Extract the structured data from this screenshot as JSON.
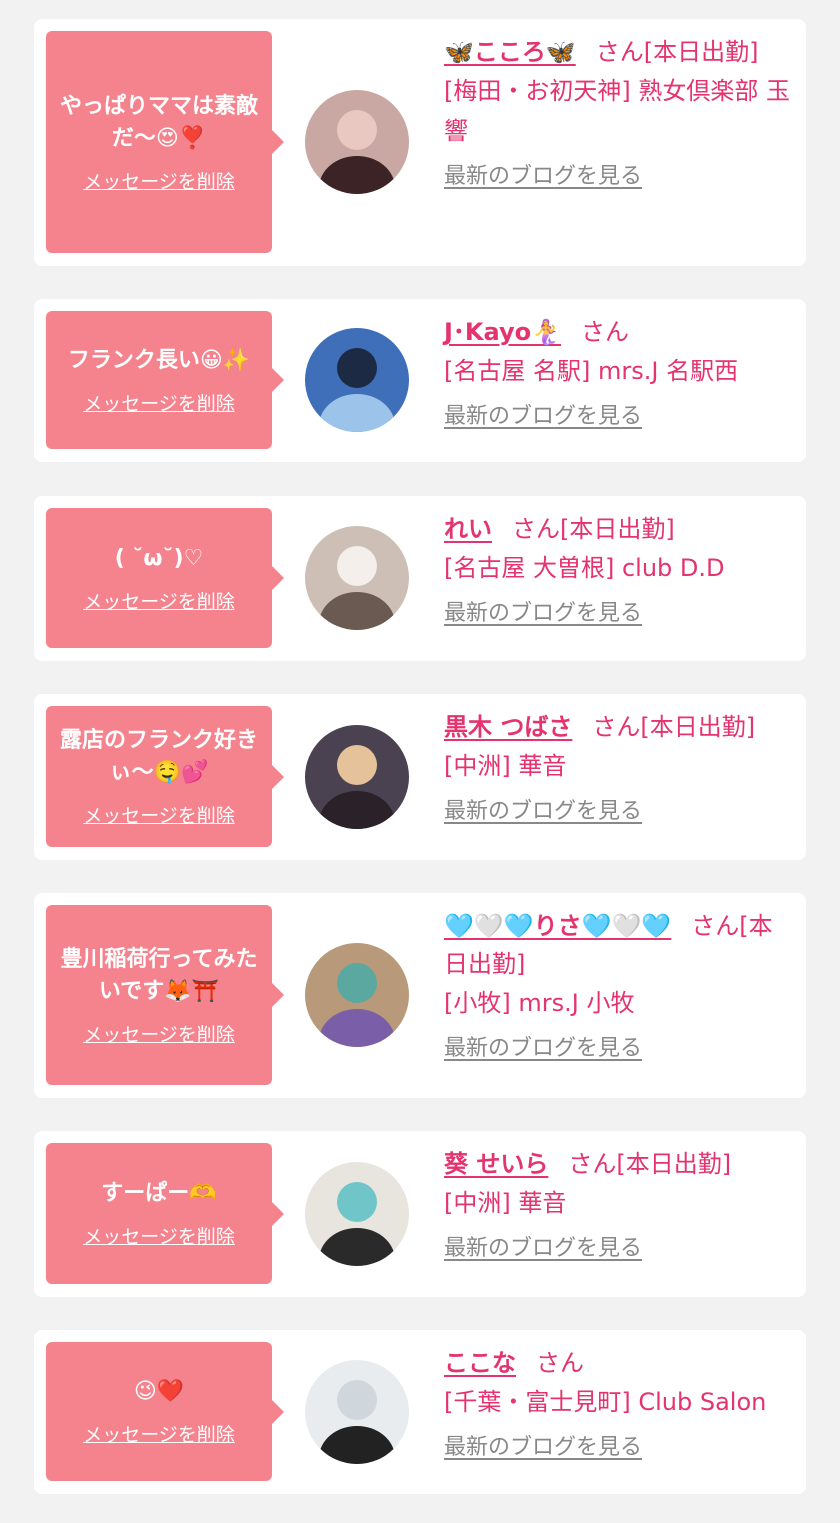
{
  "messages": [
    {
      "bubble_text": "やっぱりママは素敵だ〜😍❣️",
      "delete_label": "メッセージを削除",
      "name": "🦋こころ🦋",
      "honorific": "さん",
      "status": "[本日出勤]",
      "shop": "[梅田・お初天神] 熟女倶楽部 玉響",
      "blog_label": "最新のブログを見る"
    },
    {
      "bubble_text": "フランク長い😀✨",
      "delete_label": "メッセージを削除",
      "name": "J･Kayo🧜‍♀️",
      "honorific": "さん",
      "status": "",
      "shop": "[名古屋 名駅] mrs.J 名駅西",
      "blog_label": "最新のブログを見る"
    },
    {
      "bubble_text": "( ˘ω˘)♡",
      "delete_label": "メッセージを削除",
      "name": "れい",
      "honorific": "さん",
      "status": "[本日出勤]",
      "shop": "[名古屋 大曽根] club D.D",
      "blog_label": "最新のブログを見る"
    },
    {
      "bubble_text": "露店のフランク好きぃ〜🤤💕",
      "delete_label": "メッセージを削除",
      "name": "黒木 つばさ",
      "honorific": "さん",
      "status": "[本日出勤]",
      "shop": "[中洲] 華音",
      "blog_label": "最新のブログを見る"
    },
    {
      "bubble_text": "豊川稲荷行ってみたいです🦊⛩️",
      "delete_label": "メッセージを削除",
      "name": "🩵🤍🩵りさ🩵🤍🩵",
      "honorific": "さん",
      "status": "[本日出勤]",
      "shop": "[小牧] mrs.J 小牧",
      "blog_label": "最新のブログを見る"
    },
    {
      "bubble_text": "すーぱー🫶",
      "delete_label": "メッセージを削除",
      "name": "葵 せいら",
      "honorific": "さん",
      "status": "[本日出勤]",
      "shop": "[中洲] 華音",
      "blog_label": "最新のブログを見る"
    },
    {
      "bubble_text": "😉❤️",
      "delete_label": "メッセージを削除",
      "name": "ここな",
      "honorific": "さん",
      "status": "",
      "shop": "[千葉・富士見町] Club Salon",
      "blog_label": "最新のブログを見る"
    }
  ],
  "colors": {
    "bubble": "#f5838e",
    "accent": "#e4336e",
    "link_gray": "#888888",
    "background": "#f2f2f2"
  }
}
